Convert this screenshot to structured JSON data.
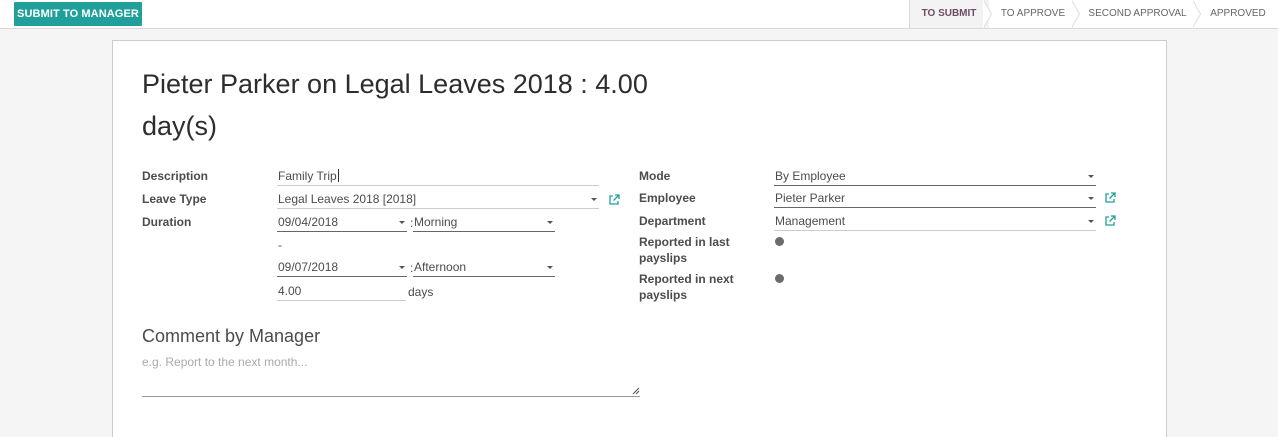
{
  "statusbar": {
    "submit_label": "SUBMIT TO MANAGER",
    "stages": [
      {
        "label": "TO SUBMIT",
        "active": true
      },
      {
        "label": "TO APPROVE",
        "active": false
      },
      {
        "label": "SECOND APPROVAL",
        "active": false
      },
      {
        "label": "APPROVED",
        "active": false
      }
    ]
  },
  "form": {
    "title": "Pieter Parker on Legal Leaves 2018 : 4.00 day(s)",
    "left": {
      "description_label": "Description",
      "description_value": "Family Trip",
      "leave_type_label": "Leave Type",
      "leave_type_value": "Legal Leaves 2018 [2018]",
      "duration_label": "Duration",
      "date_from": "09/04/2018",
      "period_from": "Morning",
      "dash": "-",
      "date_to": "09/07/2018",
      "period_to": "Afternoon",
      "colon": ":",
      "days_value": "4.00",
      "days_unit": "days"
    },
    "right": {
      "mode_label": "Mode",
      "mode_value": "By Employee",
      "employee_label": "Employee",
      "employee_value": "Pieter Parker",
      "department_label": "Department",
      "department_value": "Management",
      "reported_last_label": "Reported in last payslips",
      "reported_next_label": "Reported in next payslips"
    },
    "comment": {
      "title": "Comment by Manager",
      "placeholder": "e.g. Report to the next month..."
    }
  },
  "colors": {
    "primary": "#21a09b",
    "active_stage": "#6d4c66"
  }
}
